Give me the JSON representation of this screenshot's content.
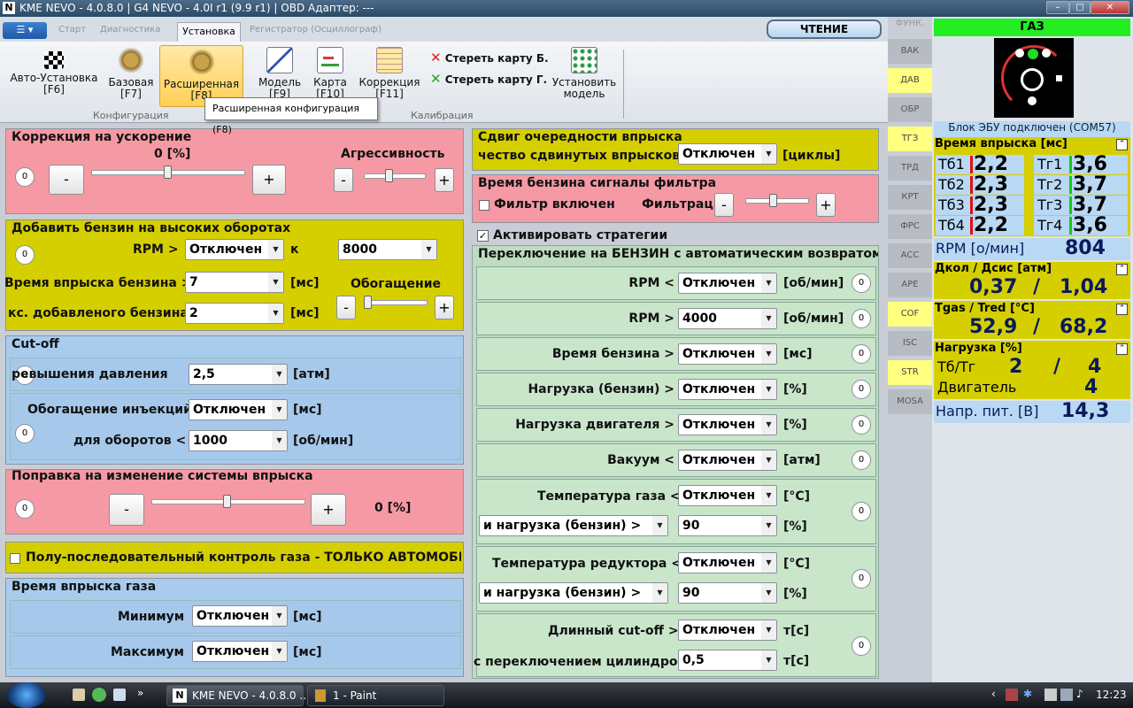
{
  "window": {
    "title": "KME NEVO - 4.0.8.0  |  G4 NEVO - 4.0I r1 (9.9 r1)  |  OBD Адаптер: ---",
    "logo": "N"
  },
  "tabs": [
    "Старт",
    "Диагностика",
    "Установка",
    "Регистратор (Осциллограф)"
  ],
  "menu_glyph": "☰ ▾",
  "read_button": "ЧТЕНИЕ",
  "ribbon": {
    "buttons": [
      {
        "label": "Авто-Установка",
        "key": "[F6]",
        "icon": "checkered-flag-icon"
      },
      {
        "label": "Базовая",
        "key": "[F7]",
        "icon": "gear-icon"
      },
      {
        "label": "Расширенная",
        "key": "[F8]",
        "icon": "gear-icon"
      },
      {
        "label": "Модель",
        "key": "[F9]",
        "icon": "graph-icon"
      },
      {
        "label": "Карта",
        "key": "[F10]",
        "icon": "map-icon"
      },
      {
        "label": "Коррекция",
        "key": "[F11]",
        "icon": "table-icon"
      },
      {
        "label": "Установить модель",
        "key": "",
        "icon": "model-icon"
      }
    ],
    "erase_b": "Стереть карту Б.",
    "erase_g": "Стереть карту Г.",
    "group_config": "Конфигурация",
    "group_calib": "Калибрация",
    "tooltip": "Расширенная конфигурация (F8)"
  },
  "sidebar": {
    "header": "ФУНК.",
    "items": [
      {
        "label": "ВАК",
        "hl": false
      },
      {
        "label": "ДАВ",
        "hl": true
      },
      {
        "label": "ОБР",
        "hl": false
      },
      {
        "label": "ТГЗ",
        "hl": true
      },
      {
        "label": "ТРД",
        "hl": false
      },
      {
        "label": "КРТ",
        "hl": false
      },
      {
        "label": "ФРС",
        "hl": false
      },
      {
        "label": "АСС",
        "hl": false
      },
      {
        "label": "АРЕ",
        "hl": false
      },
      {
        "label": "COF",
        "hl": true
      },
      {
        "label": "ISC",
        "hl": false
      },
      {
        "label": "STR",
        "hl": true
      },
      {
        "label": "MOSA",
        "hl": false
      }
    ]
  },
  "right": {
    "fuel": "ГАЗ",
    "status": "Блок ЭБУ подключен (COM57)",
    "inj_title": "Время впрыска [мс]",
    "inj": [
      {
        "l": "Тб1",
        "v": "2,2",
        "g": "Тг1",
        "gv": "3,6"
      },
      {
        "l": "Тб2",
        "v": "2,3",
        "g": "Тг2",
        "gv": "3,7"
      },
      {
        "l": "Тб3",
        "v": "2,3",
        "g": "Тг3",
        "gv": "3,7"
      },
      {
        "l": "Тб4",
        "v": "2,2",
        "g": "Тг4",
        "gv": "3,6"
      }
    ],
    "rpm_label": "RPM [о/мин]",
    "rpm": "804",
    "press_title": "Дкол / Дсис [атм]",
    "press1": "0,37",
    "slash": "/",
    "press2": "1,04",
    "temp_title": "Tgas / Tred [°C]",
    "temp1": "52,9",
    "temp2": "68,2",
    "load_title": "Нагрузка [%]",
    "load_l1": "Тб/Тг",
    "load_v1": "2",
    "load_v2": "4",
    "load_l2": "Двигатель",
    "load_v3": "4",
    "volt_label": "Напр. пит. [В]",
    "volt": "14,3",
    "collapse": "⌃"
  },
  "left": {
    "accel": {
      "title": "Коррекция на ускорение",
      "value": "0  [%]",
      "aggr": "Агрессивность",
      "zero": "0",
      "minus": "-",
      "plus": "+"
    },
    "highrpm": {
      "title": "Добавить бензин на высоких оборотах",
      "rpm_lbl": "RPM >",
      "rpm_sel": "Отключен",
      "k": "к",
      "k_sel": "8000",
      "inj_lbl": "Время впрыска бензина >",
      "inj_sel": "7",
      "ms": "[мс]",
      "enrich": "Обогащение",
      "add_lbl": "кс. добавленого бензина >",
      "add_sel": "2"
    },
    "cutoff": {
      "title": "Cut-off",
      "press_lbl": "ревышения давления",
      "press_sel": "2,5",
      "atm": "[атм]",
      "enr_lbl": "Обогащение инъекций",
      "enr_sel": "Отключен",
      "rpm_lbl": "для оборотов <",
      "rpm_sel": "1000",
      "rpm_u": "[об/мин]"
    },
    "corr": {
      "title": "Поправка на изменение системы впрыска",
      "value": "0  [%]"
    },
    "semi": "Полу-последовательный контроль газа - ТОЛЬКО АВТОМОБИЛ",
    "gasinj": {
      "title": "Время впрыска газа",
      "min": "Минимум",
      "max": "Максимум",
      "min_sel": "Отключен",
      "max_sel": "Отключен"
    }
  },
  "middle": {
    "shift": {
      "title": "Сдвиг очередности впрыска",
      "lbl": "чество сдвинутых впрысков",
      "sel": "Отключен",
      "unit": "[циклы]"
    },
    "filter": {
      "title": "Время бензина сигналы фильтра",
      "chk": "Фильтр включен",
      "lbl": "Фильтраци"
    },
    "strat": "Активировать стратегии",
    "switch_title": "Переключение на БЕНЗИН с автоматическим возвратом на",
    "rows": [
      {
        "lbl": "RPM <",
        "sel": "Отключен",
        "unit": "[об/мин]"
      },
      {
        "lbl": "RPM >",
        "sel": "4000",
        "unit": "[об/мин]"
      },
      {
        "lbl": "Время бензина >",
        "sel": "Отключен",
        "unit": "[мс]"
      },
      {
        "lbl": "Нагрузка (бензин) >",
        "sel": "Отключен",
        "unit": "[%]"
      },
      {
        "lbl": "Нагрузка двигателя >",
        "sel": "Отключен",
        "unit": "[%]"
      },
      {
        "lbl": "Вакуум <",
        "sel": "Отключен",
        "unit": "[атм]"
      }
    ],
    "gas_temp": {
      "lbl": "Температура газа <",
      "sel": "Отключен",
      "unit": "[°C]",
      "sub": "и нагрузка (бензин) >",
      "sub_sel": "90",
      "sub_unit": "[%]"
    },
    "red_temp": {
      "lbl": "Температура редуктора <",
      "sel": "Отключен",
      "unit": "[°C]",
      "sub": "и нагрузка (бензин) >",
      "sub_sel": "90",
      "sub_unit": "[%]"
    },
    "cutoff_long": {
      "lbl": "Длинный cut-off >",
      "sel": "Отключен",
      "unit": "т[c]",
      "sub": "с переключением цилиндров",
      "sub_sel": "0,5",
      "sub_unit": "т[c]"
    }
  },
  "taskbar": {
    "task1": "KME NEVO - 4.0.8.0 ...",
    "task2": "1 - Paint",
    "clock": "12:23",
    "lang": "EN"
  }
}
